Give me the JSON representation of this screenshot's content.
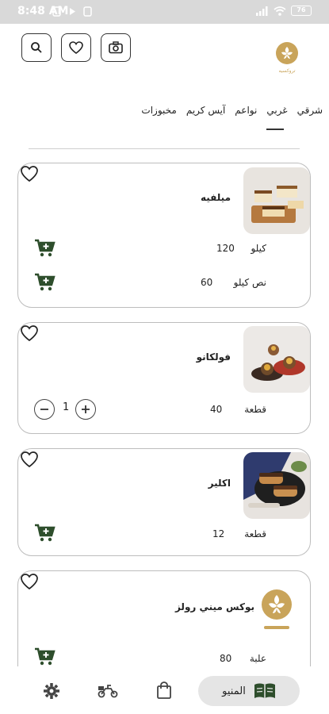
{
  "status": {
    "time": "8:48 AM",
    "battery": "76"
  },
  "tabs": [
    "شرقي",
    "غربي",
    "نواعم",
    "آيس كريم",
    "مخبوزات"
  ],
  "logo": {
    "text": "تروكسيه"
  },
  "products": [
    {
      "name": "ميلفيه",
      "rows": [
        {
          "unit": "كيلو",
          "price": "120"
        },
        {
          "unit": "نص كيلو",
          "price": "60"
        }
      ]
    },
    {
      "name": "فولكانو",
      "rows": [
        {
          "unit": "قطعة",
          "price": "40",
          "quantity": "1"
        }
      ]
    },
    {
      "name": "اكلير",
      "rows": [
        {
          "unit": "قطعة",
          "price": "12"
        }
      ]
    },
    {
      "name": "بوكس ميني رولز",
      "rows": [
        {
          "unit": "علبة",
          "price": "80"
        }
      ]
    }
  ],
  "nav": {
    "menu_label": "المنيو"
  },
  "colors": {
    "accent": "#2e4e2c",
    "logo": "#c9a45a"
  }
}
